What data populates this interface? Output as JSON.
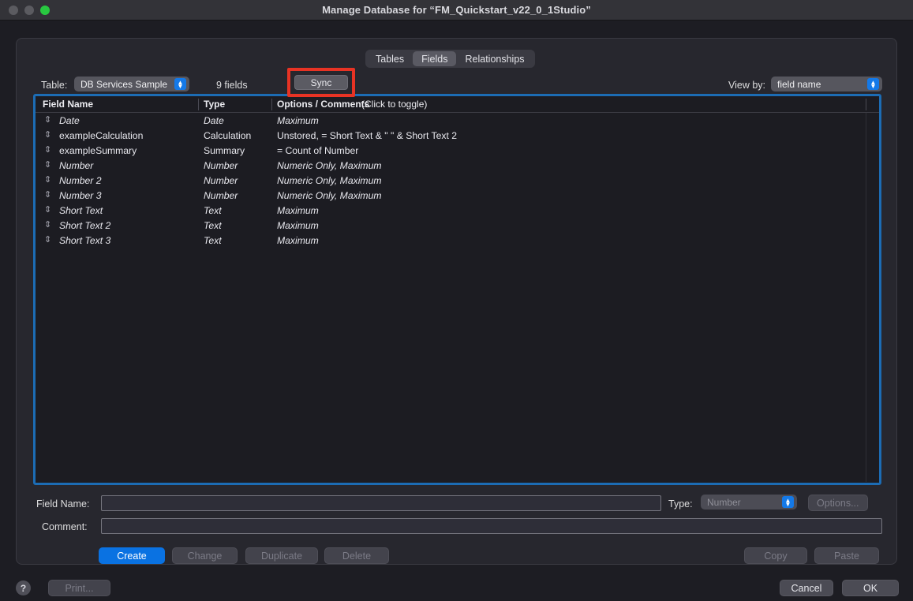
{
  "window": {
    "title": "Manage Database for “FM_Quickstart_v22_0_1Studio”",
    "traffic_lights": [
      "close",
      "minimize",
      "zoom"
    ]
  },
  "tabs": [
    {
      "label": "Tables",
      "active": false
    },
    {
      "label": "Fields",
      "active": true
    },
    {
      "label": "Relationships",
      "active": false
    }
  ],
  "toolbar": {
    "table_label": "Table:",
    "table_value": "DB Services Sample D...",
    "fields_count": "9 fields",
    "sync_label": "Sync",
    "viewby_label": "View by:",
    "viewby_value": "field name"
  },
  "list": {
    "columns": [
      {
        "label": "Field Name"
      },
      {
        "label": "Type"
      },
      {
        "label": "Options / Comments"
      },
      {
        "label": "(Click to toggle)"
      }
    ],
    "rows": [
      {
        "handle": "⇕",
        "name": "Date",
        "type": "Date",
        "options": "Maximum",
        "italic": true
      },
      {
        "handle": "⇕",
        "name": "exampleCalculation",
        "type": "Calculation",
        "options": "Unstored, = Short Text & \" \" & Short Text 2",
        "italic": false
      },
      {
        "handle": "⇕",
        "name": "exampleSummary",
        "type": "Summary",
        "options": "= Count of Number",
        "italic": false
      },
      {
        "handle": "⇕",
        "name": "Number",
        "type": "Number",
        "options": "Numeric Only, Maximum",
        "italic": true
      },
      {
        "handle": "⇕",
        "name": "Number 2",
        "type": "Number",
        "options": "Numeric Only, Maximum",
        "italic": true
      },
      {
        "handle": "⇕",
        "name": "Number 3",
        "type": "Number",
        "options": "Numeric Only, Maximum",
        "italic": true
      },
      {
        "handle": "⇕",
        "name": "Short Text",
        "type": "Text",
        "options": "Maximum",
        "italic": true
      },
      {
        "handle": "⇕",
        "name": "Short Text 2",
        "type": "Text",
        "options": "Maximum",
        "italic": true
      },
      {
        "handle": "⇕",
        "name": "Short Text 3",
        "type": "Text",
        "options": "Maximum",
        "italic": true
      }
    ]
  },
  "form": {
    "fieldname_label": "Field Name:",
    "fieldname_value": "",
    "fieldname_placeholder": "",
    "comment_label": "Comment:",
    "comment_value": "",
    "comment_placeholder": "",
    "type_label": "Type:",
    "type_value": "Number",
    "options_label": "Options..."
  },
  "actions": {
    "create": "Create",
    "change": "Change",
    "duplicate": "Duplicate",
    "delete": "Delete",
    "copy": "Copy",
    "paste": "Paste"
  },
  "footer": {
    "help": "?",
    "print": "Print...",
    "cancel": "Cancel",
    "ok": "OK"
  },
  "colors": {
    "accent_blue": "#0a72e2",
    "focus_ring": "#1c6cb4",
    "annotation_red": "#e83324",
    "stepper_blue": "#1479e8",
    "zoom_green": "#28c840",
    "window_bg": "#1d1d23",
    "panel_bg": "#27272e",
    "list_bg": "#1c1c22"
  }
}
